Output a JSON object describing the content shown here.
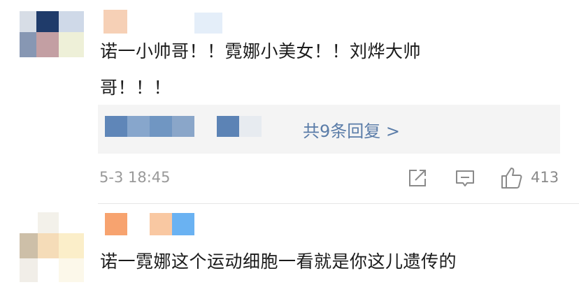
{
  "comments": [
    {
      "text_line1": "诺一小帅哥！！霓娜小美女！！刘烨大帅",
      "text_line2": "哥！！！",
      "replies_label": "共9条回复 >",
      "time": "5-3 18:45",
      "likes": "413"
    },
    {
      "text": "诺一霓娜这个运动细胞一看就是你这儿遗传的"
    }
  ],
  "icons": {
    "share": "share-icon",
    "comment": "comment-icon",
    "like": "thumbs-up-icon"
  },
  "colors": {
    "link": "#5a7ca8",
    "muted": "#999999",
    "reply_bg": "#f4f4f4"
  }
}
